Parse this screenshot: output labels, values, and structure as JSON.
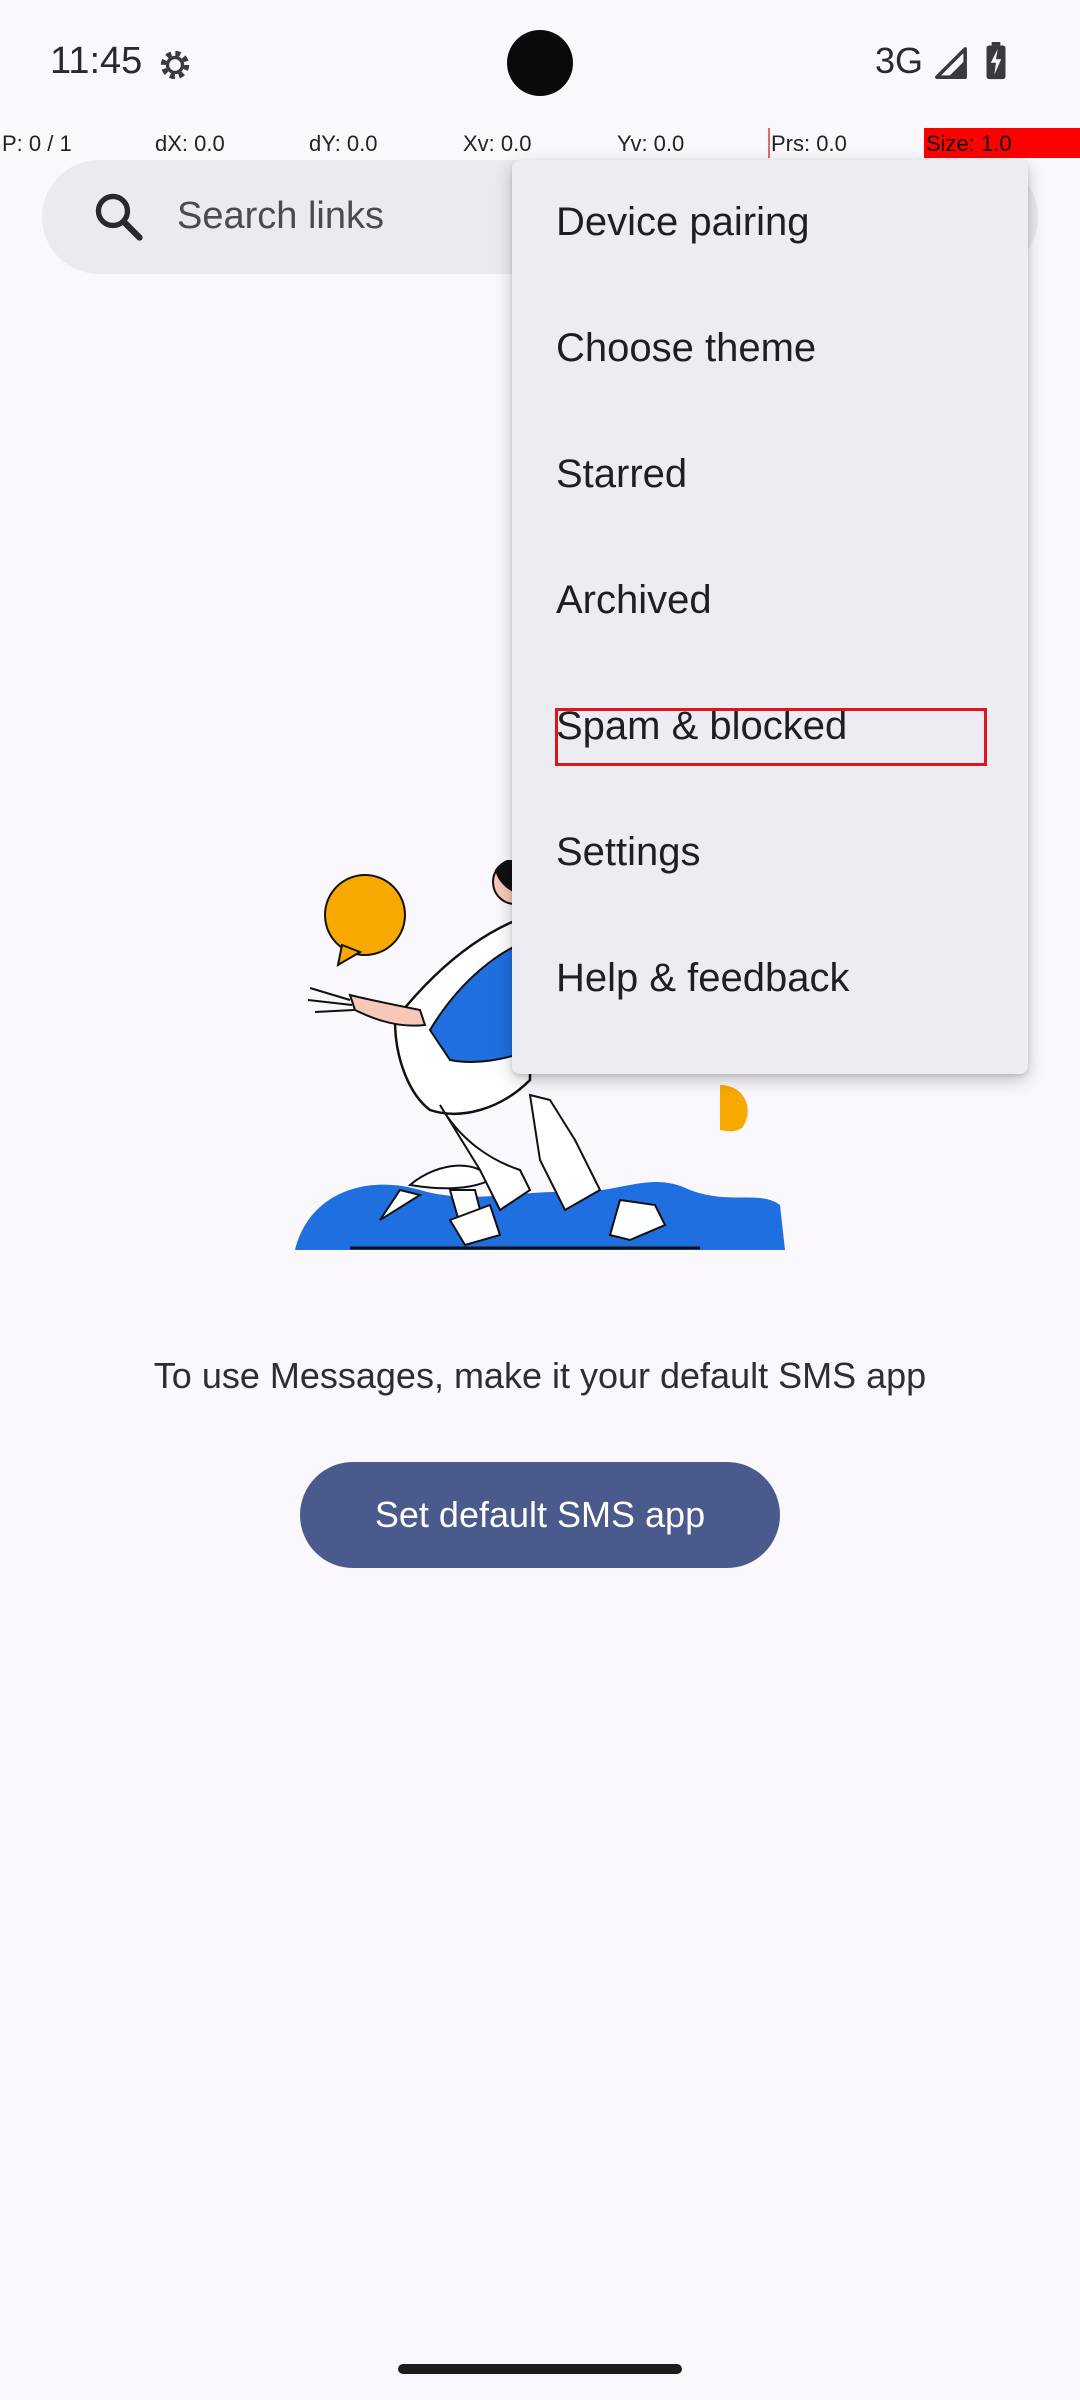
{
  "status_bar": {
    "time": "11:45",
    "network": "3G",
    "icons": [
      "settings-gear-icon",
      "signal-icon",
      "battery-charging-icon"
    ]
  },
  "debug_overlay": {
    "pointer": "P: 0 / 1",
    "dx": "dX: 0.0",
    "dy": "dY: 0.0",
    "xv": "Xv: 0.0",
    "yv": "Yv: 0.0",
    "prs": "Prs: 0.0",
    "size": "Size: 1.0"
  },
  "search": {
    "placeholder": "Search links",
    "icon": "search-icon"
  },
  "menu": {
    "items": [
      {
        "label": "Device pairing"
      },
      {
        "label": "Choose theme"
      },
      {
        "label": "Starred"
      },
      {
        "label": "Archived"
      },
      {
        "label": "Spam & blocked"
      },
      {
        "label": "Settings"
      },
      {
        "label": "Help & feedback"
      }
    ],
    "highlighted_index": 4
  },
  "empty_state": {
    "message": "To use Messages, make it your default SMS app",
    "button_label": "Set default SMS app"
  },
  "colors": {
    "accent_button": "#4a5a8c",
    "menu_background": "#eeecf3",
    "search_background": "#eceaf0",
    "highlight_border": "#e0141e",
    "illustration_blue": "#1f6fe0",
    "illustration_yellow": "#f7a900"
  }
}
